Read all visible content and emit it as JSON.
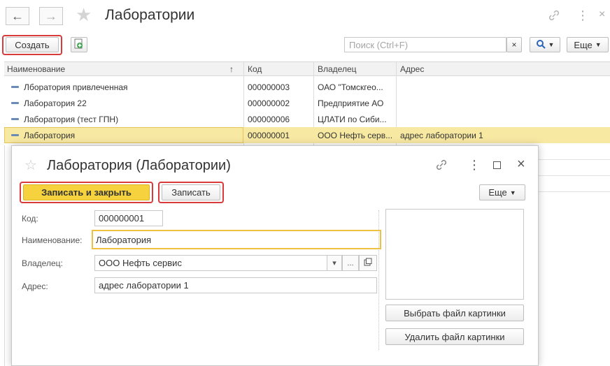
{
  "window": {
    "title": "Лаборатории",
    "back_icon": "arrow-left-icon",
    "forward_icon": "arrow-right-icon",
    "favorite_icon": "star-icon",
    "link_icon": "link-icon",
    "more_icon": "more-vertical-icon",
    "close_icon": "close-icon"
  },
  "toolbar": {
    "create_label": "Создать",
    "copy_icon": "copy-document-icon",
    "search_placeholder": "Поиск (Ctrl+F)",
    "clear_search": "×",
    "search_icon": "search-icon",
    "more_label": "Еще"
  },
  "table": {
    "columns": [
      "Наименование",
      "Код",
      "Владелец",
      "Адрес"
    ],
    "sort_indicator": "↑",
    "rows": [
      {
        "name": "Лборатория привлеченная",
        "code": "000000003",
        "owner": "ОАО \"Томскгео...",
        "address": ""
      },
      {
        "name": "Лаборатория 22",
        "code": "000000002",
        "owner": "Предприятие АО",
        "address": ""
      },
      {
        "name": "Лаборатория (тест ГПН)",
        "code": "000000006",
        "owner": "ЦЛАТИ по Сиби...",
        "address": ""
      },
      {
        "name": "Лаборатория",
        "code": "000000001",
        "owner": "ООО Нефть серв...",
        "address": "адрес лаборатории 1"
      }
    ]
  },
  "dialog": {
    "title": "Лаборатория (Лаборатории)",
    "save_close_label": "Записать и закрыть",
    "save_label": "Записать",
    "more_label": "Еще",
    "fields": {
      "code_label": "Код:",
      "code_value": "000000001",
      "name_label": "Наименование:",
      "name_value": "Лаборатория",
      "owner_label": "Владелец:",
      "owner_value": "ООО Нефть сервис",
      "owner_dropdown": "▾",
      "owner_select": "...",
      "owner_open_icon": "open-form-icon",
      "address_label": "Адрес:",
      "address_value": "адрес лаборатории 1"
    },
    "choose_picture_label": "Выбрать файл картинки",
    "delete_picture_label": "Удалить файл картинки"
  },
  "colors": {
    "highlight_frame": "#d93a3a",
    "primary_button": "#f5d23e",
    "selected_row": "#f7e9a2",
    "focus_border": "#f0c040"
  }
}
